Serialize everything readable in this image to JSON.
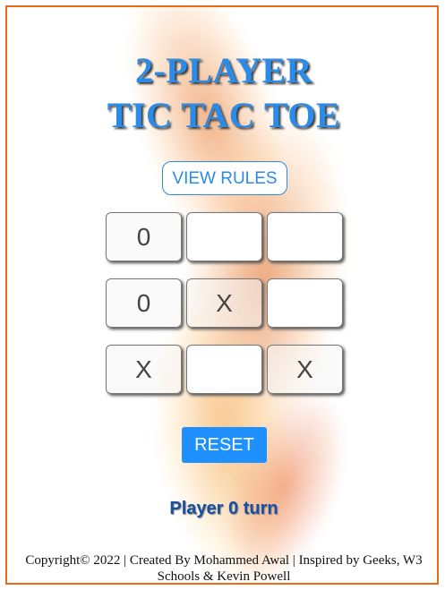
{
  "title": {
    "line1": "2-PLAYER",
    "line2": "TIC TAC TOE"
  },
  "rules_button": "VIEW RULES",
  "board": [
    [
      "0",
      "",
      ""
    ],
    [
      "0",
      "X",
      ""
    ],
    [
      "X",
      "",
      "X"
    ]
  ],
  "reset_button": "RESET",
  "status": "Player 0 turn",
  "footer": {
    "line1": "Copyright© 2022 | Created By Mohammed Awal | Inspired by Geeks, W3",
    "line2": "Schools & Kevin Powell"
  },
  "colors": {
    "accent": "#2b8be6",
    "border": "#e86a1c",
    "button": "#1e90ff"
  }
}
